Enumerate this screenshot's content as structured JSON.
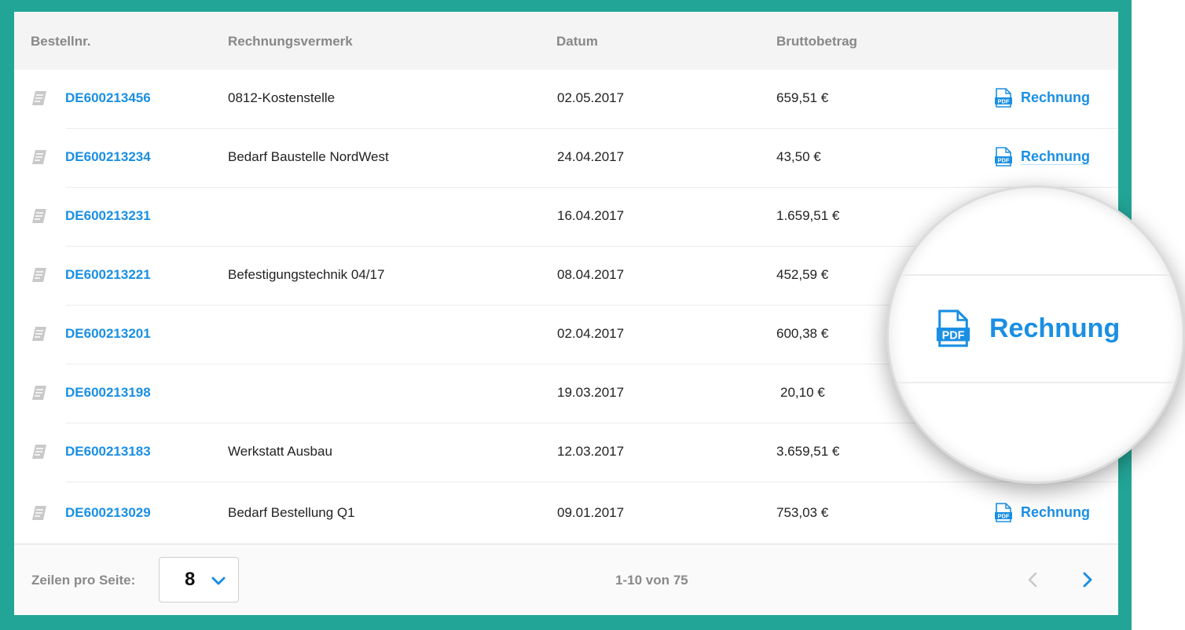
{
  "colors": {
    "frame": "#22a596",
    "link": "#1a8fe3",
    "header_text": "#888888"
  },
  "table": {
    "columns": [
      "Bestellnr.",
      "Rechnungsvermerk",
      "Datum",
      "Bruttobetrag"
    ],
    "rows": [
      {
        "order": "DE600213456",
        "note": "0812-Kostenstelle",
        "date": "02.05.2017",
        "amount": "659,51 €",
        "invoice": "Rechnung"
      },
      {
        "order": "DE600213234",
        "note": "Bedarf Baustelle NordWest",
        "date": "24.04.2017",
        "amount": "43,50 €",
        "invoice": "Rechnung"
      },
      {
        "order": "DE600213231",
        "note": "",
        "date": "16.04.2017",
        "amount": "1.659,51 €",
        "invoice": ""
      },
      {
        "order": "DE600213221",
        "note": "Befestigungstechnik 04/17",
        "date": "08.04.2017",
        "amount": "452,59 €",
        "invoice": ""
      },
      {
        "order": "DE600213201",
        "note": "",
        "date": "02.04.2017",
        "amount": "600,38 €",
        "invoice": ""
      },
      {
        "order": "DE600213198",
        "note": "",
        "date": "19.03.2017",
        "amount": "20,10 €",
        "invoice": ""
      },
      {
        "order": "DE600213183",
        "note": "Werkstatt Ausbau",
        "date": "12.03.2017",
        "amount": "3.659,51 €",
        "invoice": ""
      },
      {
        "order": "DE600213029",
        "note": "Bedarf Bestellung Q1",
        "date": "09.01.2017",
        "amount": "753,03 €",
        "invoice": "Rechnung"
      }
    ]
  },
  "icons": {
    "order": "document-icon",
    "invoice": "pdf-icon",
    "select": "chevron-down-icon",
    "prev": "chevron-left-icon",
    "next": "chevron-right-icon"
  },
  "pagination": {
    "rows_label": "Zeilen pro Seite:",
    "rows_value": "8",
    "range_text": "1-10 von 75"
  },
  "magnifier": {
    "label": "Rechnung"
  }
}
